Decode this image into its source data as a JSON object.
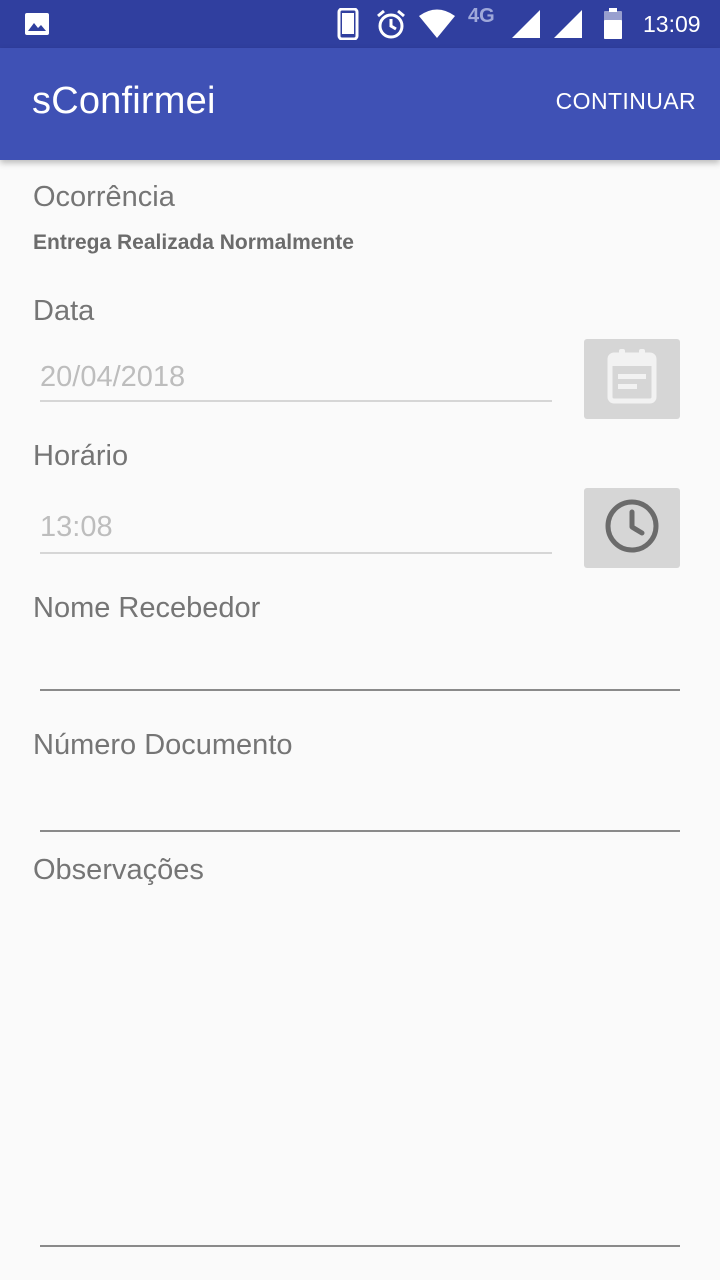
{
  "status_bar": {
    "time": "13:09",
    "network": "4G",
    "icons": [
      "image-icon",
      "phone-icon",
      "alarm-icon",
      "wifi-icon",
      "signal-icon",
      "signal-icon",
      "battery-icon"
    ]
  },
  "app_bar": {
    "title": "sConfirmei",
    "action_label": "CONTINUAR",
    "color": "#3f51b5",
    "status_color": "#303f9f"
  },
  "form": {
    "ocorrencia": {
      "label": "Ocorrência",
      "value": "Entrega Realizada Normalmente"
    },
    "data": {
      "label": "Data",
      "value": "20/04/2018",
      "button_icon": "calendar-icon"
    },
    "horario": {
      "label": "Horário",
      "value": "13:08",
      "button_icon": "clock-icon"
    },
    "nome_recebedor": {
      "label": "Nome Recebedor",
      "value": ""
    },
    "numero_documento": {
      "label": "Número Documento",
      "value": ""
    },
    "observacoes": {
      "label": "Observações",
      "value": ""
    }
  }
}
